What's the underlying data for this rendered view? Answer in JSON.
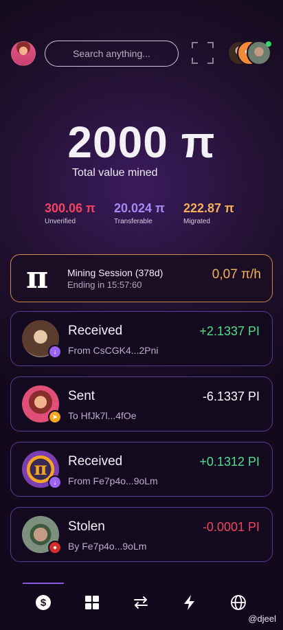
{
  "search": {
    "placeholder": "Search anything..."
  },
  "balance": {
    "value": "2000 π",
    "label": "Total value mined"
  },
  "stats": [
    {
      "value": "300.06 π",
      "label": "Unverified",
      "color": "#f2435f"
    },
    {
      "value": "20.024 π",
      "label": "Transferable",
      "color": "#a98af5"
    },
    {
      "value": "222.87 π",
      "label": "Migrated",
      "color": "#f3b15a"
    }
  ],
  "mining": {
    "title": "Mining Session (378d)",
    "subtitle": "Ending in 15:57:60",
    "rate": "0,07 π/h",
    "icon": "π"
  },
  "transactions": [
    {
      "title": "Received",
      "subtitle": "From CsCGK4...2Pni",
      "amount": "+2.1337 PI",
      "amount_color": "#4ee08a",
      "badge": "arrow-down-icon",
      "badge_color": "#9a62f0"
    },
    {
      "title": "Sent",
      "subtitle": "To HfJk7l...4fOe",
      "amount": "-6.1337 PI",
      "amount_color": "#ffffff",
      "badge": "send-icon",
      "badge_color": "#f5a623"
    },
    {
      "title": "Received",
      "subtitle": "From Fe7p4o...9oLm",
      "amount": "+0.1312 PI",
      "amount_color": "#4ee08a",
      "badge": "arrow-down-icon",
      "badge_color": "#9a62f0"
    },
    {
      "title": "Stolen",
      "subtitle": "By Fe7p4o...9oLm",
      "amount": "-0.0001 PI",
      "amount_color": "#f2435f",
      "badge": "drop-icon",
      "badge_color": "#d12d2d"
    }
  ],
  "nav": [
    "dollar-icon",
    "grid-icon",
    "transfer-icon",
    "bolt-icon",
    "globe-icon"
  ],
  "credit": "@djeel"
}
